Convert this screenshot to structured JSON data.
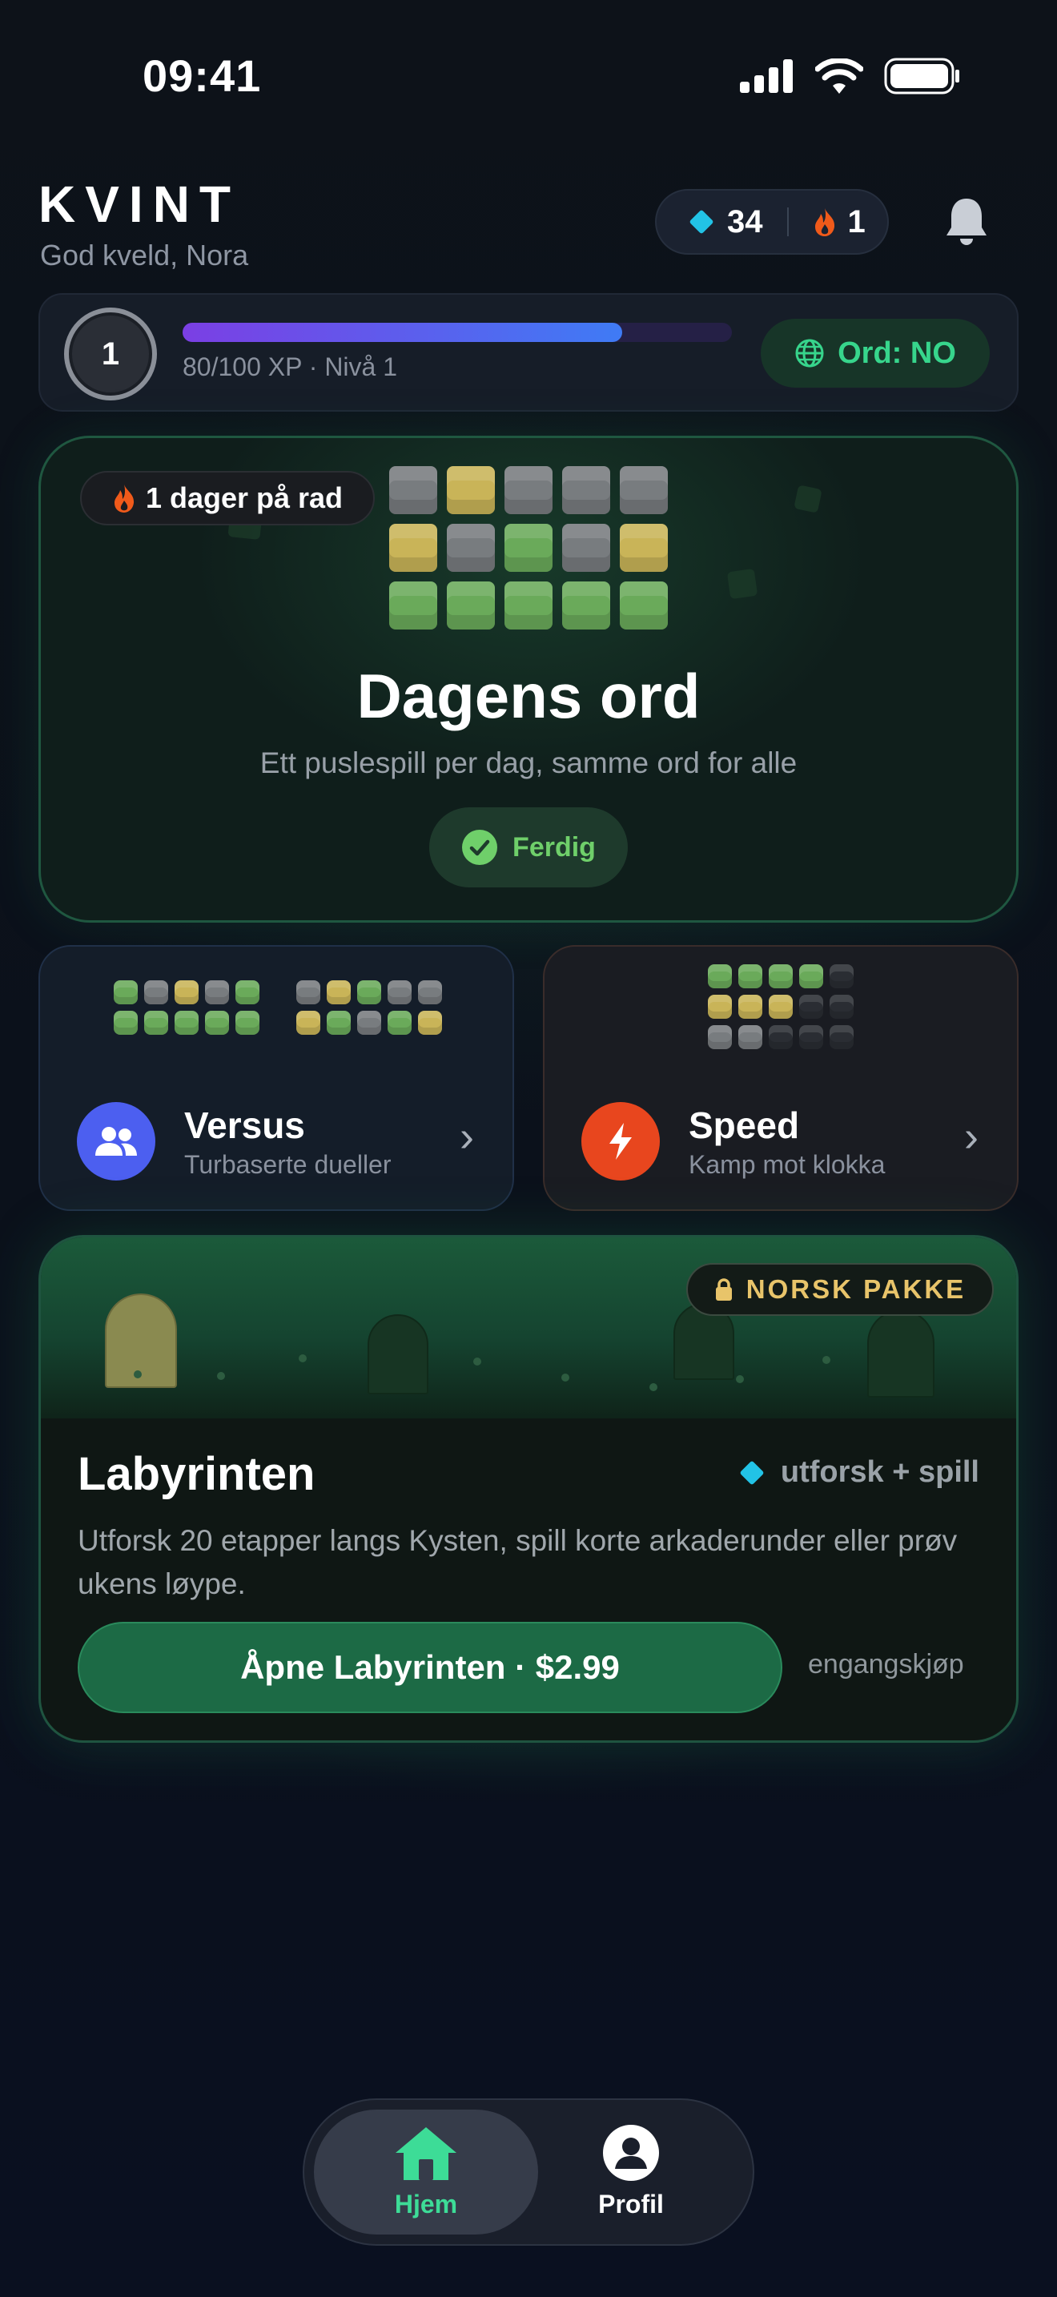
{
  "status_bar": {
    "time": "09:41"
  },
  "header": {
    "logo": "KVINT",
    "greeting": "God kveld, Nora",
    "gems": "34",
    "streak": "1"
  },
  "level": {
    "number": "1",
    "xp_progress": 0.8,
    "xp_text": "80/100 XP · Nivå 1",
    "language": "Ord: NO"
  },
  "daily": {
    "streak_label": "1 dager på rad",
    "title": "Dagens ord",
    "subtitle": "Ett puslespill per dag, samme ord for alle",
    "status": "Ferdig",
    "grid": [
      [
        "gray",
        "yellow",
        "gray",
        "gray",
        "gray"
      ],
      [
        "yellow",
        "gray",
        "green",
        "gray",
        "yellow"
      ],
      [
        "green",
        "green",
        "green",
        "green",
        "green"
      ]
    ]
  },
  "modes": [
    {
      "title": "Versus",
      "subtitle": "Turbaserte dueller",
      "icon": "users-icon"
    },
    {
      "title": "Speed",
      "subtitle": "Kamp mot klokka",
      "icon": "lightning-icon"
    }
  ],
  "labyrinth": {
    "badge": "NORSK PAKKE",
    "title": "Labyrinten",
    "tag": "utforsk + spill",
    "description": "Utforsk 20 etapper langs Kysten, spill korte arkaderunder eller prøv ukens løype.",
    "button": "Åpne Labyrinten · $2.99",
    "note": "engangskjøp"
  },
  "tabs": [
    {
      "label": "Hjem",
      "icon": "home-icon",
      "active": true
    },
    {
      "label": "Profil",
      "icon": "profile-icon",
      "active": false
    }
  ],
  "colors": {
    "green_tile": "#6aaa5a",
    "yellow_tile": "#c9b458",
    "gray_tile": "#787c7f",
    "accent_green": "#37d58c",
    "versus_blue": "#4c5ff0",
    "speed_orange": "#e8461e"
  }
}
